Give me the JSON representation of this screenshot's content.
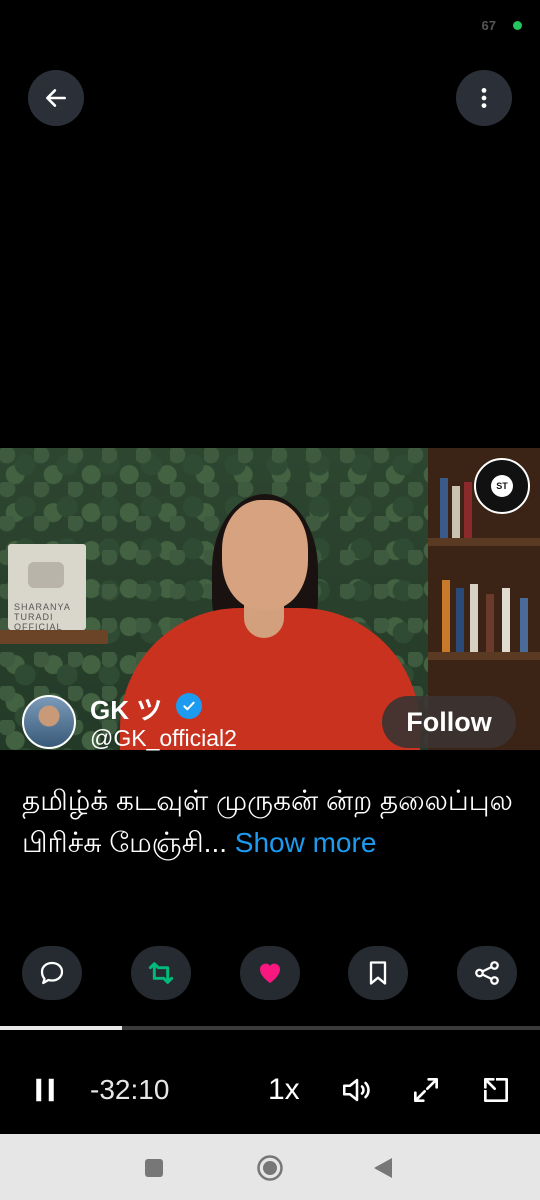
{
  "status_bar": {
    "number": "67",
    "dot_color": "#22c55e"
  },
  "author": {
    "name": "GK ツ",
    "handle": "@GK_official2",
    "follow_label": "Follow"
  },
  "tweet": {
    "text": "தமிழ்க் கடவுள் முருகன் ன்ற தலைப்புல பிரிச்சு மேஞ்சி...",
    "show_more": "Show more"
  },
  "video": {
    "plaque_text": "SHARANYA TURADI OFFICIAL",
    "badge_text": "ST"
  },
  "player": {
    "time_remaining": "-32:10",
    "speed": "1x",
    "progress": 0.225
  },
  "colors": {
    "accent": "#1d9bf0",
    "like": "#f91880",
    "repost": "#00ba7c",
    "button_bg": "#262b31"
  }
}
